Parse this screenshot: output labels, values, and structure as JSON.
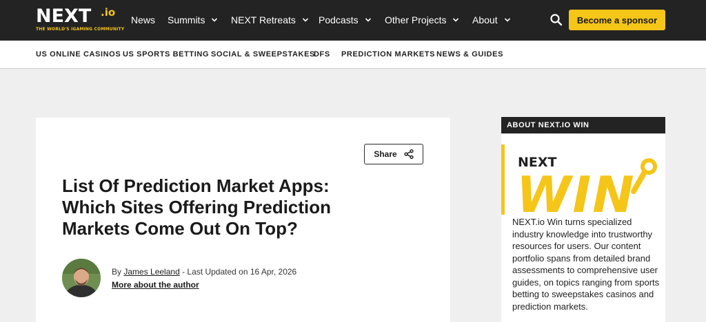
{
  "brand": {
    "logo_main": "NEXT",
    "logo_io": ".io",
    "tagline": "THE WORLD'S iGAMING COMMUNITY"
  },
  "topnav": {
    "items": [
      {
        "label": "News",
        "has_dropdown": false
      },
      {
        "label": "Summits",
        "has_dropdown": true
      },
      {
        "label": "NEXT Retreats",
        "has_dropdown": true
      },
      {
        "label": "Podcasts",
        "has_dropdown": true
      },
      {
        "label": "Other Projects",
        "has_dropdown": true
      },
      {
        "label": "About",
        "has_dropdown": true
      }
    ],
    "search_icon": "search-icon",
    "sponsor_label": "Become a sponsor"
  },
  "subnav": {
    "items": [
      "US ONLINE CASINOS",
      "US SPORTS BETTING",
      "SOCIAL & SWEEPSTAKES",
      "DFS",
      "PREDICTION MARKETS",
      "NEWS & GUIDES"
    ]
  },
  "article": {
    "share_label": "Share",
    "share_icon": "share-icon",
    "title": "List Of Prediction Market Apps: Which Sites Offering Prediction Markets Come Out On Top?",
    "by_prefix": "By",
    "author": "James Leeland",
    "updated": "- Last Updated on 16 Apr, 2026",
    "more_author": "More about the author"
  },
  "sidebar": {
    "heading": "ABOUT NEXT.IO WIN",
    "logo_next": "NEXT",
    "logo_win": "WIN",
    "description": "NEXT.io Win turns specialized industry knowledge into trustworthy resources for users. Our content portfolio spans from detailed brand assessments to comprehensive user guides, on topics ranging from sports betting to sweepstakes casinos and prediction markets."
  },
  "colors": {
    "accent": "#f5c518",
    "dark": "#232323",
    "background": "#efefef"
  }
}
